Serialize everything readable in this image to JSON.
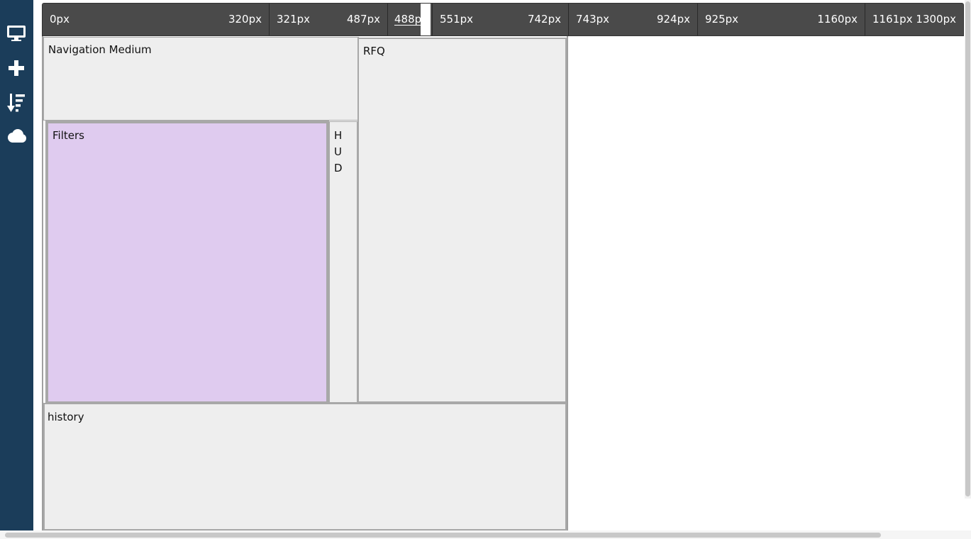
{
  "sidebar": {
    "items": [
      {
        "icon": "desktop-icon"
      },
      {
        "icon": "plus-icon"
      },
      {
        "icon": "sort-icon"
      },
      {
        "icon": "cloud-icon"
      }
    ]
  },
  "breakpoints": [
    {
      "min": "0px",
      "max": "320px"
    },
    {
      "min": "321px",
      "max": "487px"
    },
    {
      "min": "488px",
      "max": ""
    },
    {
      "min": "551px",
      "max": "742px"
    },
    {
      "min": "743px",
      "max": "924px"
    },
    {
      "min": "925px",
      "max": "1160px"
    },
    {
      "min": "1161px",
      "max": "1300px"
    }
  ],
  "active_breakpoint_label": "488p",
  "panels": {
    "navigation": "Navigation Medium",
    "rfq": "RFQ",
    "filters": "Filters",
    "hud": "HUD",
    "history": "history"
  },
  "colors": {
    "sidebar": "#1b3d5a",
    "ruler": "#4a4a4a",
    "panel": "#eeeeee",
    "filters_highlight": "#dfcbef"
  }
}
